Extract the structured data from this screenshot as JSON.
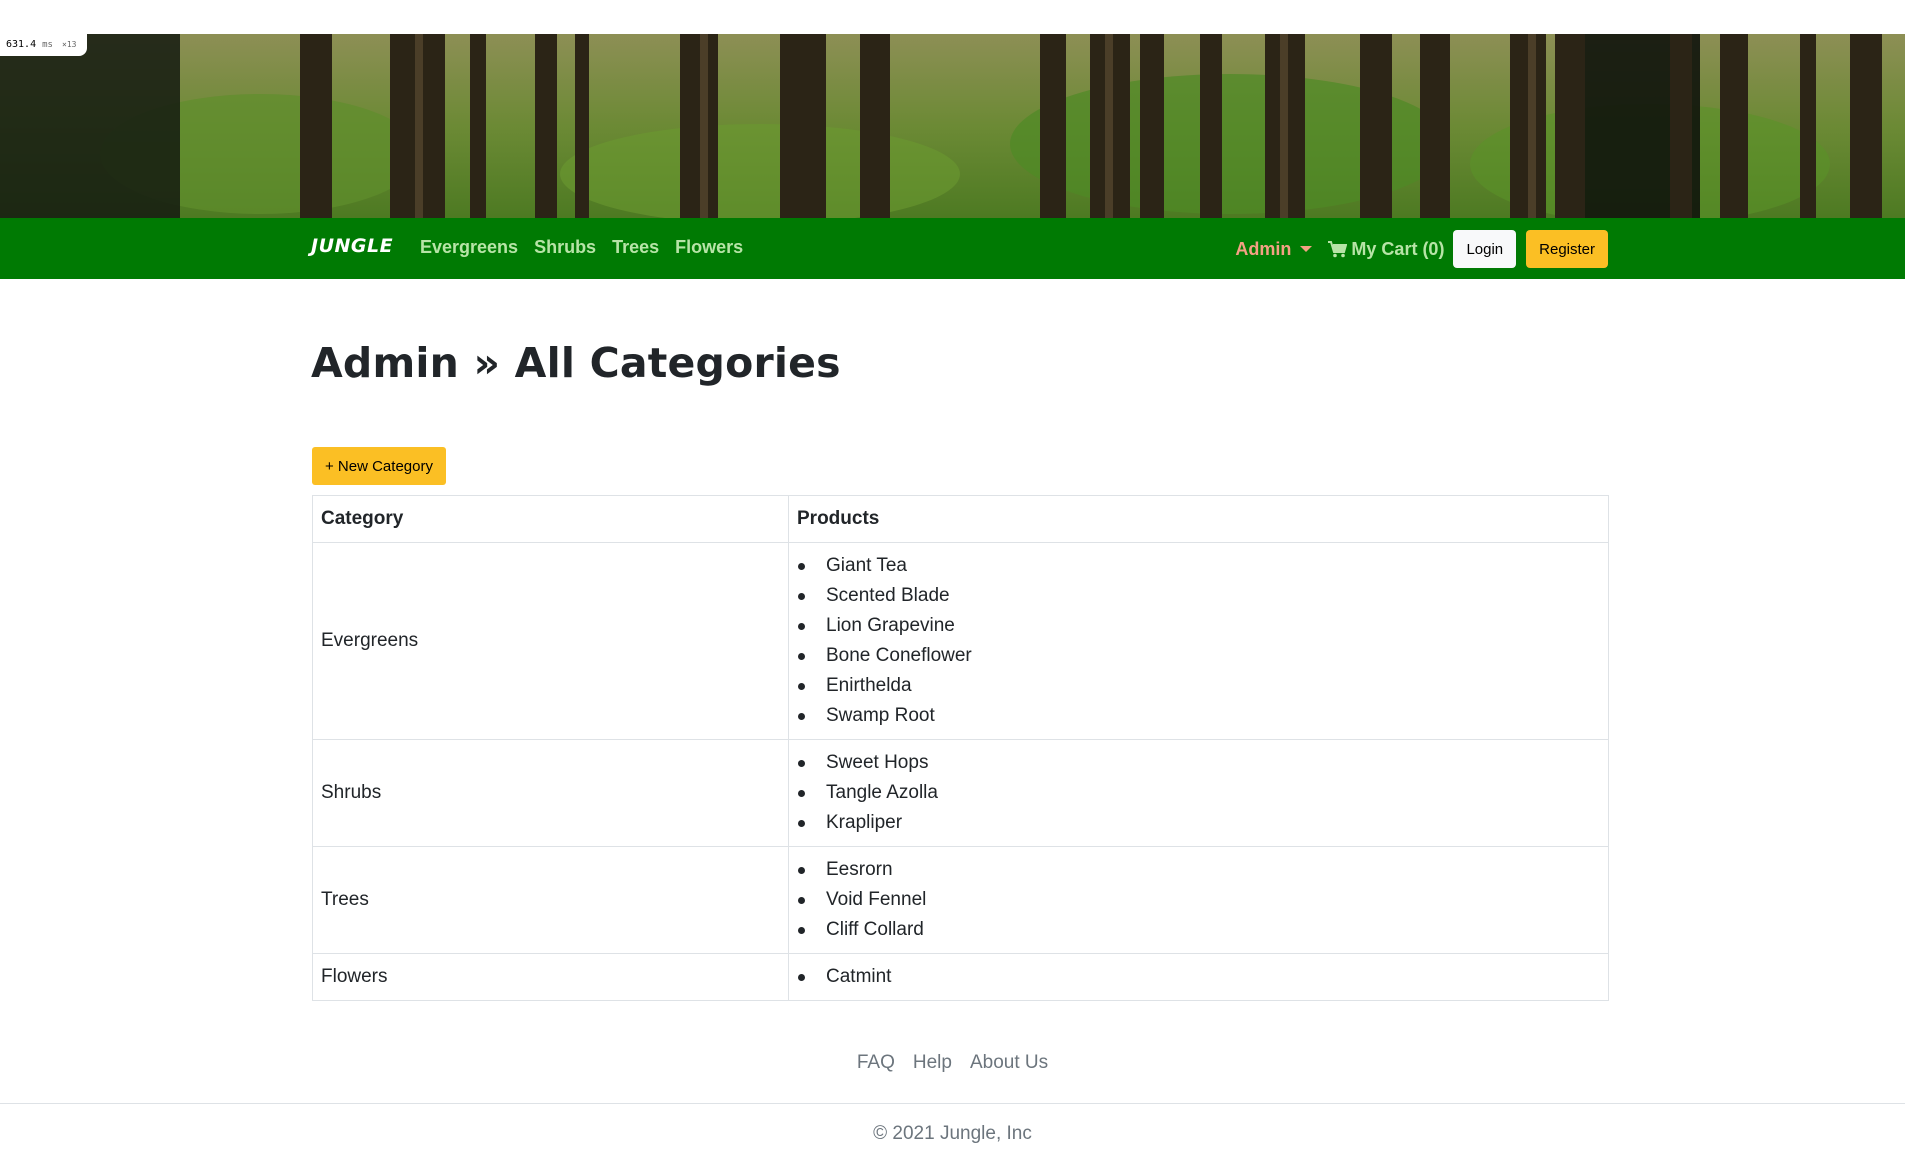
{
  "perf": {
    "value": "631.4",
    "unit": "ms",
    "count": "×13"
  },
  "banner": {
    "image": "forest-banner"
  },
  "nav": {
    "brand": "JUNGLE",
    "links": [
      "Evergreens",
      "Shrubs",
      "Trees",
      "Flowers"
    ],
    "admin_label": "Admin",
    "cart_label": "My Cart (0)",
    "login_label": "Login",
    "register_label": "Register"
  },
  "main": {
    "title": "Admin » All Categories",
    "new_button": "+ New Category",
    "table": {
      "headers": [
        "Category",
        "Products"
      ],
      "rows": [
        {
          "category": "Evergreens",
          "products": [
            "Giant Tea",
            "Scented Blade",
            "Lion Grapevine",
            "Bone Coneflower",
            "Enirthelda",
            "Swamp Root"
          ]
        },
        {
          "category": "Shrubs",
          "products": [
            "Sweet Hops",
            "Tangle Azolla",
            "Krapliper"
          ]
        },
        {
          "category": "Trees",
          "products": [
            "Eesrorn",
            "Void Fennel",
            "Cliff Collard"
          ]
        },
        {
          "category": "Flowers",
          "products": [
            "Catmint"
          ]
        }
      ]
    }
  },
  "footer": {
    "links": [
      "FAQ",
      "Help",
      "About Us"
    ],
    "copyright": "© 2021 Jungle, Inc"
  },
  "colors": {
    "navbar": "#007a03",
    "accent_yellow": "#fbbf24",
    "nav_link": "#b7e4a7",
    "admin": "#f4a184"
  }
}
